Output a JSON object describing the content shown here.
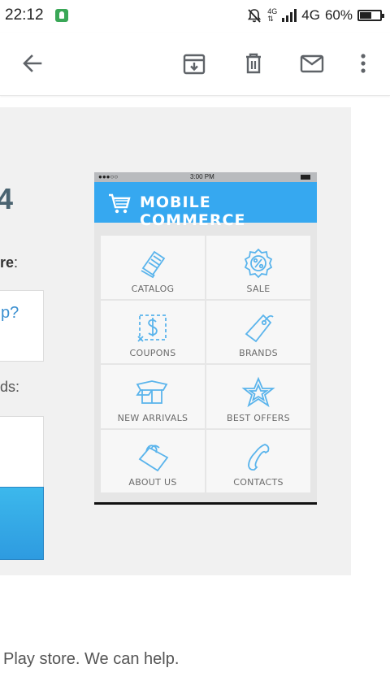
{
  "status_bar": {
    "time": "22:12",
    "network_small": "4G",
    "network": "4G",
    "battery": "60%",
    "battery_level": 0.6
  },
  "toolbar": {
    "icons": [
      "back-arrow-icon",
      "archive-icon",
      "delete-icon",
      "mail-icon",
      "more-vert-icon"
    ]
  },
  "content": {
    "heading_fragment": "4",
    "label1_bold": "re",
    "label1_tail": ":",
    "link_fragment": "p?",
    "label2": "ds:",
    "footer_text": "Play store. We can help."
  },
  "phone": {
    "status_dots": "●●●○○ ",
    "status_time": "3:00 PM",
    "title": "MOBILE COMMERCE",
    "accent_color": "#36a8f0",
    "icon_color": "#5ab4ec",
    "tiles": [
      {
        "label": "CATALOG",
        "icon": "catalog-icon"
      },
      {
        "label": "SALE",
        "icon": "sale-badge-icon"
      },
      {
        "label": "COUPONS",
        "icon": "coupon-icon"
      },
      {
        "label": "BRANDS",
        "icon": "tag-icon"
      },
      {
        "label": "NEW ARRIVALS",
        "icon": "box-icon"
      },
      {
        "label": "BEST OFFERS",
        "icon": "star-icon"
      },
      {
        "label": "ABOUT US",
        "icon": "shopping-bag-icon"
      },
      {
        "label": "CONTACTS",
        "icon": "phone-icon"
      }
    ]
  }
}
